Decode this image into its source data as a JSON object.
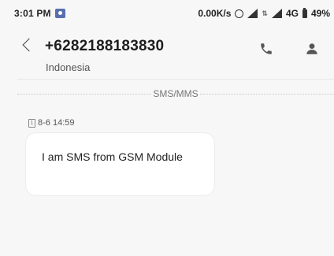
{
  "status_bar": {
    "time": "3:01 PM",
    "net_speed": "0.00K/s",
    "network_type": "4G",
    "battery": "49%",
    "icons": [
      "notification-icon",
      "alarm-icon",
      "signal-icon",
      "battery-icon"
    ]
  },
  "header": {
    "phone_number": "+6282188183830",
    "country": "Indonesia",
    "icons": [
      "back-icon",
      "phone-icon",
      "person-icon"
    ]
  },
  "thread": {
    "channel_label": "SMS/MMS",
    "messages": [
      {
        "timestamp": "8-6 14:59",
        "sim": "1",
        "text": "I am SMS from GSM Module"
      }
    ]
  },
  "colors": {
    "background": "#f7f7f7",
    "bubble": "#ffffff",
    "text": "#222222"
  }
}
